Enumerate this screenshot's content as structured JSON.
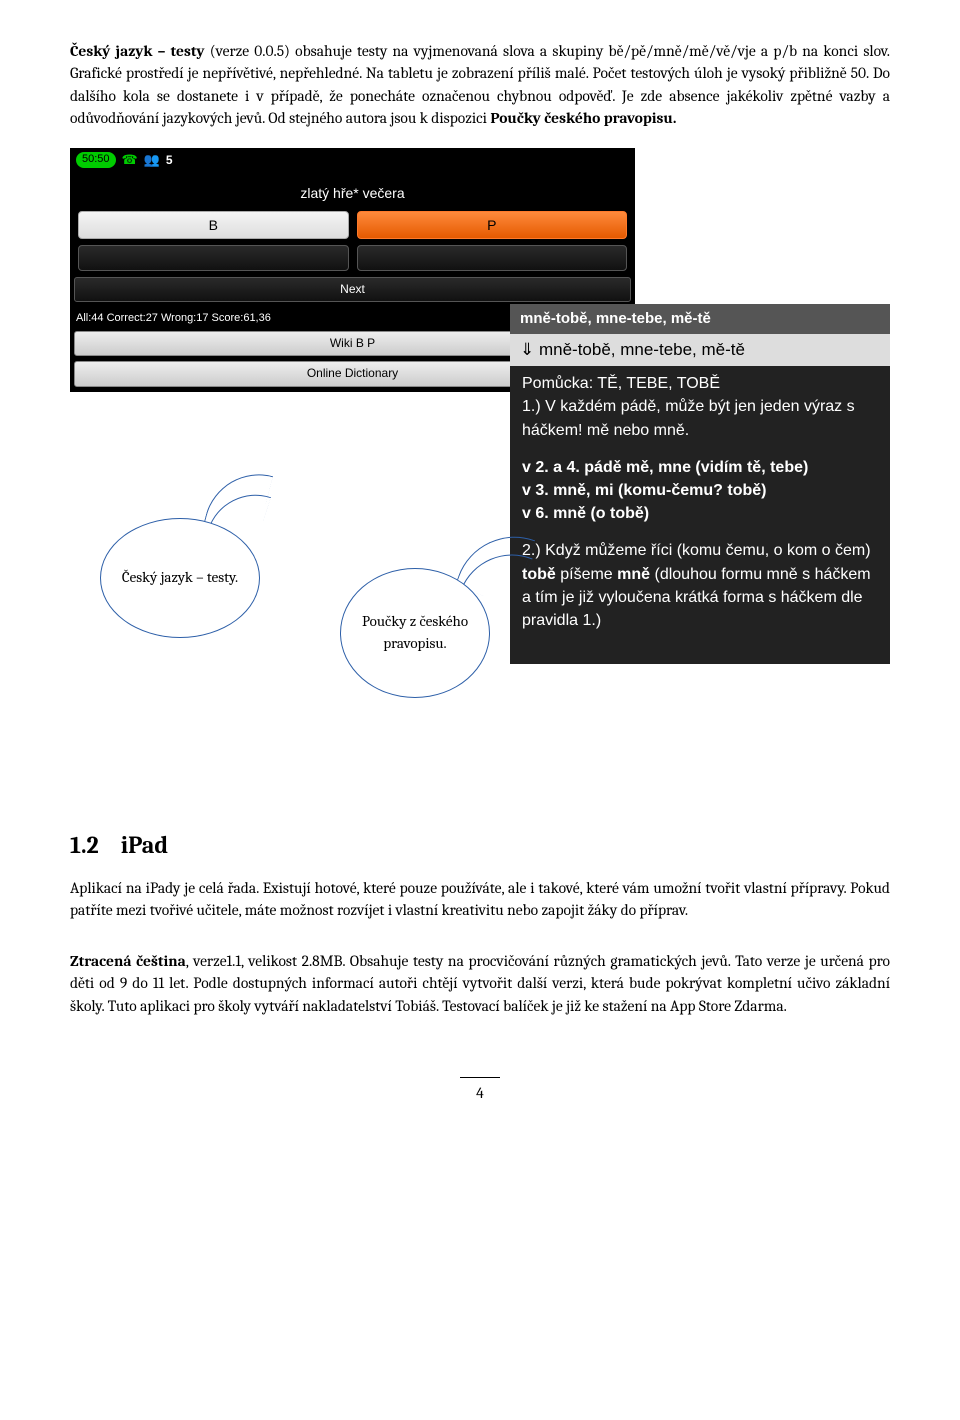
{
  "para1_a": "Český jazyk – testy",
  "para1_b": " (verze 0.0.5) obsahuje testy na vyjmenovaná slova a skupiny bě/pě/mně/mě/vě/vje a p/b na konci slov. Grafické prostředí je nepřívětivé, nepřehledné. Na tabletu je zobrazení příliš malé. Počet testových úloh je vysoký přibližně 50. Do dalšího kola se dostanete i v případě, že ponecháte označenou chybnou odpověď. Je zde absence jakékoliv zpětné vazby a odůvodňování jazykových jevů. Od stejného autora jsou k dispozici ",
  "para1_c": "Poučky českého pravopisu.",
  "app": {
    "timer": "50:50",
    "count": "5",
    "question": "zlatý hře* večera",
    "btn_b": "B",
    "btn_p": "P",
    "next": "Next",
    "score": "All:44 Correct:27 Wrong:17 Score:61,36",
    "wiki": "Wiki B P",
    "dict": "Online Dictionary"
  },
  "tip": {
    "t1": "mně-tobě, mne-tebe, mě-tě",
    "arrow": "⇓",
    "t2": " mně-tobě, mne-tebe, mě-tě",
    "p1a": "Pomůcka: TĚ, TEBE, TOBĚ",
    "p1b": "1.) V každém pádě, může být jen jeden výraz s háčkem! mě nebo mně.",
    "p2a": "v 2. a 4. pádě mě, mne (vidím tě, tebe)",
    "p2b": "v 3. mně, mi (komu-čemu? tobě)",
    "p2c": "v 6. mně (o tobě)",
    "p3a": "2.) Když můžeme říci (komu čemu, o kom o čem) ",
    "p3b": "tobě",
    "p3c": " píšeme ",
    "p3d": "mně",
    "p3e": " (dlouhou formu mně s háčkem a tím je již vyloučena krátká forma s háčkem dle pravidla 1.)"
  },
  "bubble1": "Český jazyk – testy.",
  "bubble2": "Poučky z českého pravopisu.",
  "h2_num": "1.2",
  "h2_txt": "iPad",
  "para2": "Aplikací na iPady je celá řada. Existují hotové, které pouze používáte, ale i takové, které vám umožní tvořit vlastní přípravy. Pokud patříte mezi tvořivé učitele, máte možnost rozvíjet i vlastní kreativitu nebo zapojit žáky do příprav.",
  "para3_a": "Ztracená čeština",
  "para3_b": ", verze1.1, velikost 2.8MB. Obsahuje testy na procvičování různých gramatických jevů. Tato verze je určená pro děti od 9 do 11 let. Podle dostupných informací autoři chtějí vytvořit další verzi, která bude pokrývat kompletní učivo základní školy. Tuto aplikaci pro školy vytváří nakladatelství Tobiáš. Testovací balíček je již ke stažení na App Store Zdarma.",
  "page": "4"
}
